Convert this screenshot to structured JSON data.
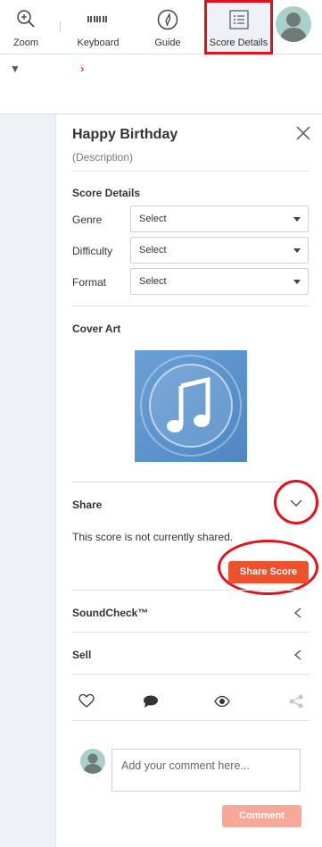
{
  "toolbar": {
    "zoom_label": "Zoom",
    "keyboard_label": "Keyboard",
    "guide_label": "Guide",
    "details_label": "Score Details"
  },
  "panel": {
    "title": "Happy Birthday",
    "description": "(Description)",
    "score_details": {
      "heading": "Score Details",
      "fields": [
        {
          "label": "Genre",
          "value": "Select"
        },
        {
          "label": "Difficulty",
          "value": "Select"
        },
        {
          "label": "Format",
          "value": "Select"
        }
      ]
    },
    "cover_art": {
      "heading": "Cover Art",
      "icon": "music-note-icon"
    },
    "share": {
      "heading": "Share",
      "note": "This score is not currently shared.",
      "button_label": "Share Score"
    },
    "soundcheck": {
      "heading": "SoundCheck™"
    },
    "sell": {
      "heading": "Sell"
    },
    "actions": [
      "heart-icon",
      "comment-icon",
      "eye-icon",
      "share-icon"
    ],
    "comment": {
      "placeholder": "Add your comment here...",
      "button_label": "Comment"
    }
  },
  "colors": {
    "accent": "#f0512d",
    "accent_disabled": "#f7a898",
    "highlight_annotation": "#e0121b"
  }
}
